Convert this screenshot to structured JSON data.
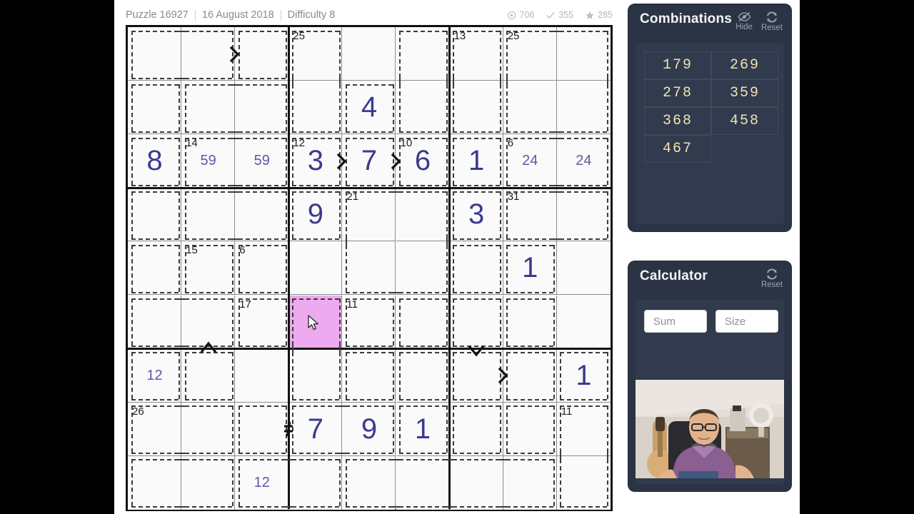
{
  "header": {
    "puzzle": "Puzzle 16927",
    "date": "16 August 2018",
    "difficulty": "Difficulty 8",
    "stats": [
      {
        "icon": "clock-icon",
        "value": "706"
      },
      {
        "icon": "check-icon",
        "value": "355"
      },
      {
        "icon": "star-icon",
        "value": "285"
      }
    ]
  },
  "combinations_panel": {
    "title": "Combinations",
    "hide_label": "Hide",
    "hide_icon": "eye-slash-icon",
    "reset_label": "Reset",
    "reset_icon": "refresh-icon",
    "combos": [
      "179",
      "269",
      "278",
      "359",
      "368",
      "458",
      "467"
    ],
    "accent_color": "#efe3b0",
    "panel_color": "#2b3445"
  },
  "calculator_panel": {
    "title": "Calculator",
    "reset_label": "Reset",
    "reset_icon": "refresh-icon",
    "sum_placeholder": "Sum",
    "size_placeholder": "Size",
    "sum_value": "",
    "size_value": "",
    "webcam_label": "webcam-video"
  },
  "grid": {
    "rows": 9,
    "cols": 9,
    "selected_cell": {
      "row": 6,
      "col": 4
    },
    "selected_color": "#eeaaee",
    "digit_color": "#3b3a8f",
    "values": [
      [
        "",
        "",
        "",
        "",
        "",
        "",
        "",
        "",
        ""
      ],
      [
        "",
        "",
        "",
        "",
        "4",
        "",
        "",
        "",
        ""
      ],
      [
        "8",
        "59",
        "59",
        "3",
        "7",
        "6",
        "1",
        "24",
        "24"
      ],
      [
        "",
        "",
        "",
        "9",
        "",
        "",
        "3",
        "",
        ""
      ],
      [
        "",
        "",
        "",
        "",
        "",
        "",
        "",
        "1",
        ""
      ],
      [
        "",
        "",
        "",
        "",
        "",
        "",
        "",
        "",
        ""
      ],
      [
        "12",
        "",
        "",
        "",
        "",
        "",
        "",
        "",
        "1"
      ],
      [
        "",
        "",
        "",
        "7",
        "9",
        "1",
        "",
        "",
        ""
      ],
      [
        "",
        "",
        "12",
        "",
        "",
        "",
        "",
        "",
        ""
      ]
    ],
    "pencil_cells": [
      {
        "row": 3,
        "col": 2,
        "text": "59"
      },
      {
        "row": 3,
        "col": 3,
        "text": "59"
      },
      {
        "row": 3,
        "col": 8,
        "text": "24"
      },
      {
        "row": 3,
        "col": 9,
        "text": "24"
      },
      {
        "row": 7,
        "col": 1,
        "text": "12"
      },
      {
        "row": 9,
        "col": 3,
        "text": "12"
      }
    ],
    "cage_sums": [
      {
        "row": 1,
        "col": 4,
        "sum": "25"
      },
      {
        "row": 1,
        "col": 7,
        "sum": "13"
      },
      {
        "row": 1,
        "col": 8,
        "sum": "25"
      },
      {
        "row": 3,
        "col": 2,
        "sum": "14"
      },
      {
        "row": 3,
        "col": 4,
        "sum": "12"
      },
      {
        "row": 3,
        "col": 6,
        "sum": "10"
      },
      {
        "row": 3,
        "col": 8,
        "sum": "6"
      },
      {
        "row": 4,
        "col": 5,
        "sum": "21"
      },
      {
        "row": 4,
        "col": 8,
        "sum": "31"
      },
      {
        "row": 5,
        "col": 2,
        "sum": "15"
      },
      {
        "row": 5,
        "col": 3,
        "sum": "6"
      },
      {
        "row": 6,
        "col": 3,
        "sum": "17"
      },
      {
        "row": 6,
        "col": 5,
        "sum": "11"
      },
      {
        "row": 8,
        "col": 1,
        "sum": "26"
      },
      {
        "row": 8,
        "col": 9,
        "sum": "11"
      }
    ],
    "inequalities": [
      {
        "type": "greater-right",
        "row": 1,
        "col": 2,
        "glyph": ">"
      },
      {
        "type": "greater-right",
        "row": 3,
        "col": 4,
        "glyph": ">"
      },
      {
        "type": "greater-right",
        "row": 3,
        "col": 5,
        "glyph": ">"
      },
      {
        "type": "less-up",
        "row": 6,
        "col": 2,
        "glyph": "^"
      },
      {
        "type": "greater-down",
        "row": 6,
        "col": 7,
        "glyph": "v"
      },
      {
        "type": "greater-right",
        "row": 7,
        "col": 7,
        "glyph": ">"
      },
      {
        "type": "not-equal",
        "row": 8,
        "col": 3,
        "glyph": "≠"
      }
    ],
    "cages": [
      {
        "cells": [
          [
            1,
            1
          ],
          [
            1,
            2
          ]
        ]
      },
      {
        "cells": [
          [
            1,
            3
          ]
        ]
      },
      {
        "cells": [
          [
            2,
            1
          ]
        ]
      },
      {
        "cells": [
          [
            2,
            2
          ],
          [
            2,
            3
          ]
        ]
      },
      {
        "cells": [
          [
            1,
            4
          ],
          [
            2,
            4
          ]
        ]
      },
      {
        "cells": [
          [
            2,
            5
          ]
        ]
      },
      {
        "cells": [
          [
            1,
            6
          ],
          [
            2,
            6
          ]
        ]
      },
      {
        "cells": [
          [
            1,
            7
          ],
          [
            2,
            7
          ]
        ]
      },
      {
        "cells": [
          [
            1,
            8
          ],
          [
            1,
            9
          ],
          [
            2,
            8
          ],
          [
            2,
            9
          ]
        ]
      },
      {
        "cells": [
          [
            3,
            1
          ]
        ]
      },
      {
        "cells": [
          [
            3,
            2
          ],
          [
            3,
            3
          ]
        ]
      },
      {
        "cells": [
          [
            3,
            4
          ]
        ]
      },
      {
        "cells": [
          [
            3,
            5
          ]
        ]
      },
      {
        "cells": [
          [
            3,
            6
          ]
        ]
      },
      {
        "cells": [
          [
            3,
            7
          ]
        ]
      },
      {
        "cells": [
          [
            3,
            8
          ],
          [
            3,
            9
          ]
        ]
      },
      {
        "cells": [
          [
            4,
            1
          ]
        ]
      },
      {
        "cells": [
          [
            4,
            2
          ],
          [
            4,
            3
          ]
        ]
      },
      {
        "cells": [
          [
            4,
            4
          ]
        ]
      },
      {
        "cells": [
          [
            4,
            5
          ],
          [
            4,
            6
          ],
          [
            5,
            5
          ],
          [
            5,
            6
          ]
        ]
      },
      {
        "cells": [
          [
            4,
            7
          ]
        ]
      },
      {
        "cells": [
          [
            4,
            8
          ],
          [
            4,
            9
          ]
        ]
      },
      {
        "cells": [
          [
            5,
            1
          ]
        ]
      },
      {
        "cells": [
          [
            5,
            2
          ]
        ]
      },
      {
        "cells": [
          [
            5,
            3
          ]
        ]
      },
      {
        "cells": [
          [
            5,
            7
          ]
        ]
      },
      {
        "cells": [
          [
            5,
            8
          ]
        ]
      },
      {
        "cells": [
          [
            6,
            1
          ],
          [
            6,
            2
          ]
        ]
      },
      {
        "cells": [
          [
            6,
            3
          ]
        ]
      },
      {
        "cells": [
          [
            6,
            4
          ],
          [
            7,
            4
          ]
        ]
      },
      {
        "cells": [
          [
            6,
            5
          ]
        ]
      },
      {
        "cells": [
          [
            6,
            6
          ]
        ]
      },
      {
        "cells": [
          [
            6,
            7
          ]
        ]
      },
      {
        "cells": [
          [
            6,
            8
          ]
        ]
      },
      {
        "cells": [
          [
            7,
            1
          ]
        ]
      },
      {
        "cells": [
          [
            7,
            2
          ]
        ]
      },
      {
        "cells": [
          [
            7,
            5
          ]
        ]
      },
      {
        "cells": [
          [
            7,
            6
          ]
        ]
      },
      {
        "cells": [
          [
            7,
            7
          ]
        ]
      },
      {
        "cells": [
          [
            7,
            8
          ]
        ]
      },
      {
        "cells": [
          [
            7,
            9
          ]
        ]
      },
      {
        "cells": [
          [
            8,
            1
          ],
          [
            8,
            2
          ]
        ]
      },
      {
        "cells": [
          [
            8,
            3
          ]
        ]
      },
      {
        "cells": [
          [
            8,
            4
          ],
          [
            8,
            5
          ]
        ]
      },
      {
        "cells": [
          [
            8,
            6
          ]
        ]
      },
      {
        "cells": [
          [
            8,
            7
          ]
        ]
      },
      {
        "cells": [
          [
            8,
            8
          ]
        ]
      },
      {
        "cells": [
          [
            8,
            9
          ],
          [
            9,
            9
          ]
        ]
      },
      {
        "cells": [
          [
            9,
            1
          ],
          [
            9,
            2
          ]
        ]
      },
      {
        "cells": [
          [
            9,
            3
          ],
          [
            9,
            4
          ]
        ]
      },
      {
        "cells": [
          [
            9,
            5
          ],
          [
            9,
            6
          ],
          [
            9,
            7
          ],
          [
            9,
            8
          ]
        ]
      }
    ]
  }
}
